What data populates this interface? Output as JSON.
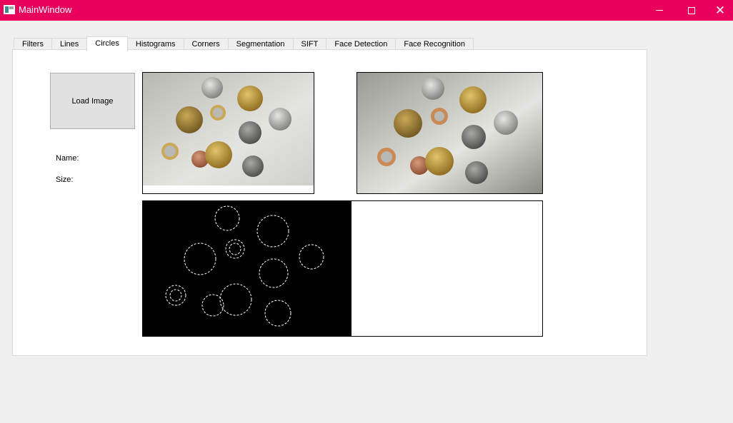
{
  "window": {
    "title": "MainWindow",
    "controls": {
      "minimize": "—",
      "maximize": "☐",
      "close": "✕"
    }
  },
  "tabs": [
    {
      "label": "Filters",
      "active": false
    },
    {
      "label": "Lines",
      "active": false
    },
    {
      "label": "Circles",
      "active": true
    },
    {
      "label": "Histograms",
      "active": false
    },
    {
      "label": "Corners",
      "active": false
    },
    {
      "label": "Segmentation",
      "active": false
    },
    {
      "label": "SIFT",
      "active": false
    },
    {
      "label": "Face Detection",
      "active": false
    },
    {
      "label": "Face Recognition",
      "active": false
    }
  ],
  "circles_tab": {
    "load_button_label": "Load Image",
    "name_label": "Name:",
    "size_label": "Size:",
    "images": {
      "original": "coins-original-photo",
      "result": "coins-detected-circles-photo",
      "edges": "coins-edge-map"
    }
  },
  "colors": {
    "titlebar": "#e8005c",
    "panel_bg": "#ffffff",
    "window_bg": "#f0f0f0"
  }
}
